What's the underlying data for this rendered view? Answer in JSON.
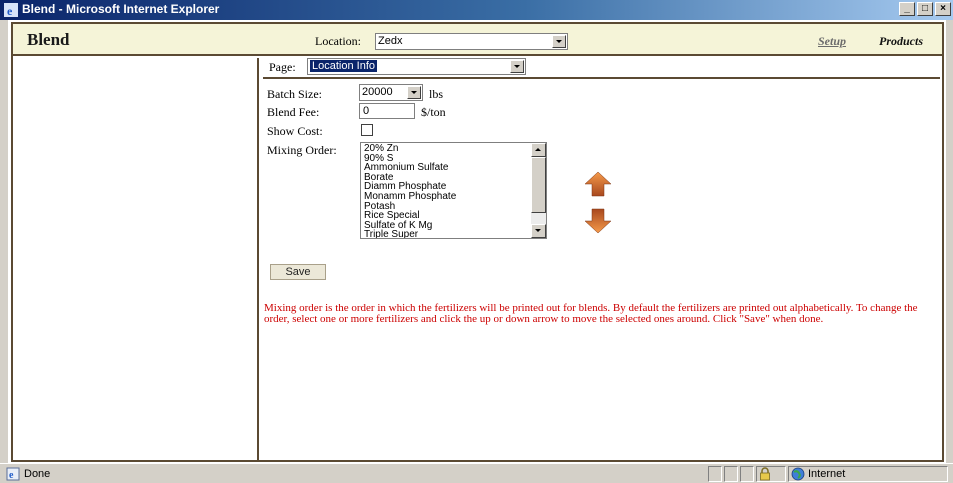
{
  "window": {
    "title": "Blend - Microsoft Internet Explorer",
    "buttons": [
      "_",
      "□",
      "×"
    ]
  },
  "header": {
    "app_title": "Blend",
    "location_label": "Location:",
    "location_value": "Zedx",
    "setup_label": "Setup",
    "products_label": "Products"
  },
  "form": {
    "page_label": "Page:",
    "page_value": "Location Info",
    "batch_size_label": "Batch Size:",
    "batch_size_value": "20000",
    "batch_size_unit": "lbs",
    "blend_fee_label": "Blend Fee:",
    "blend_fee_value": "0",
    "blend_fee_unit": "$/ton",
    "show_cost_label": "Show Cost:",
    "show_cost_checked": false,
    "mixing_order_label": "Mixing Order:",
    "mixing_order_items": [
      "20% Zn",
      "90% S",
      "Ammonium Sulfate",
      "Borate",
      "Diamm Phosphate",
      "Monamm Phosphate",
      "Potash",
      "Rice Special",
      "Sulfate of K Mg",
      "Triple Super"
    ],
    "save_label": "Save",
    "help_text": "Mixing order is the order in which the fertilizers will be printed out for blends. By default the fertilizers are printed out alphabetically. To change the order, select one or more fertilizers and click the up or down arrow to move the selected ones around. Click \"Save\" when done."
  },
  "statusbar": {
    "status_text": "Done",
    "zone_text": "Internet"
  },
  "colors": {
    "title_bar": "#0a246a",
    "border_brown": "#5b4a33",
    "help_red": "#cc0000",
    "header_bg": "#f5f4d8",
    "arrow_orange": "#e07a2a"
  }
}
